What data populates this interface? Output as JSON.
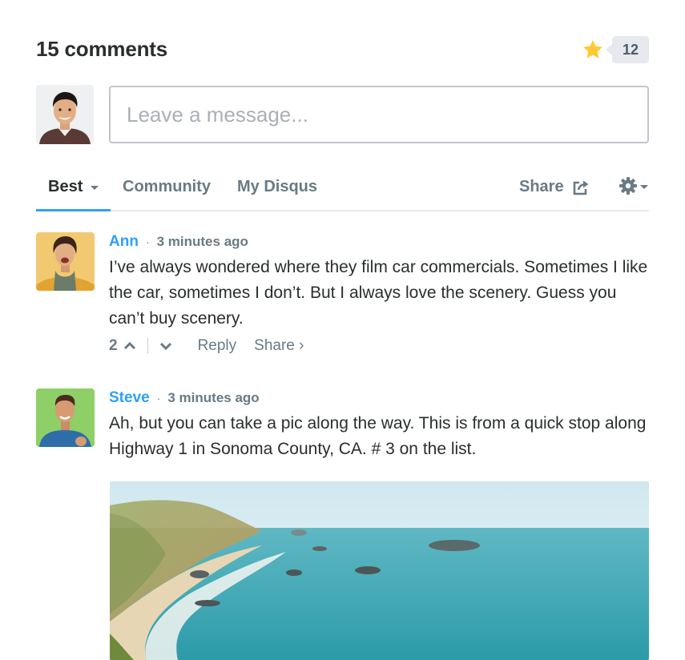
{
  "header": {
    "comment_count": "15 comments",
    "favorite_count": "12"
  },
  "composer": {
    "placeholder": "Leave a message..."
  },
  "nav": {
    "tabs": [
      "Best",
      "Community",
      "My Disqus"
    ],
    "share_label": "Share"
  },
  "comments": [
    {
      "author": "Ann",
      "separator": "·",
      "time": "3 minutes ago",
      "text": "I’ve always wondered where they film car commercials. Sometimes I like the car, sometimes I don’t. But I always love the scenery. Guess you can’t buy scenery.",
      "votes": "2",
      "reply_label": "Reply",
      "share_label": "Share ›"
    },
    {
      "author": "Steve",
      "separator": "·",
      "time": "3 minutes ago",
      "text": "Ah, but you can take a pic along the way. This is from a quick stop along Highway 1 in Sonoma County, CA. # 3 on the list."
    }
  ],
  "colors": {
    "accent": "#2e9fff",
    "text": "#2a2e2e",
    "muted": "#687a86",
    "star": "#ffc933"
  },
  "icons": [
    "star-icon",
    "share-arrow-icon",
    "gear-icon",
    "upvote-chevron-icon",
    "downvote-chevron-icon"
  ]
}
